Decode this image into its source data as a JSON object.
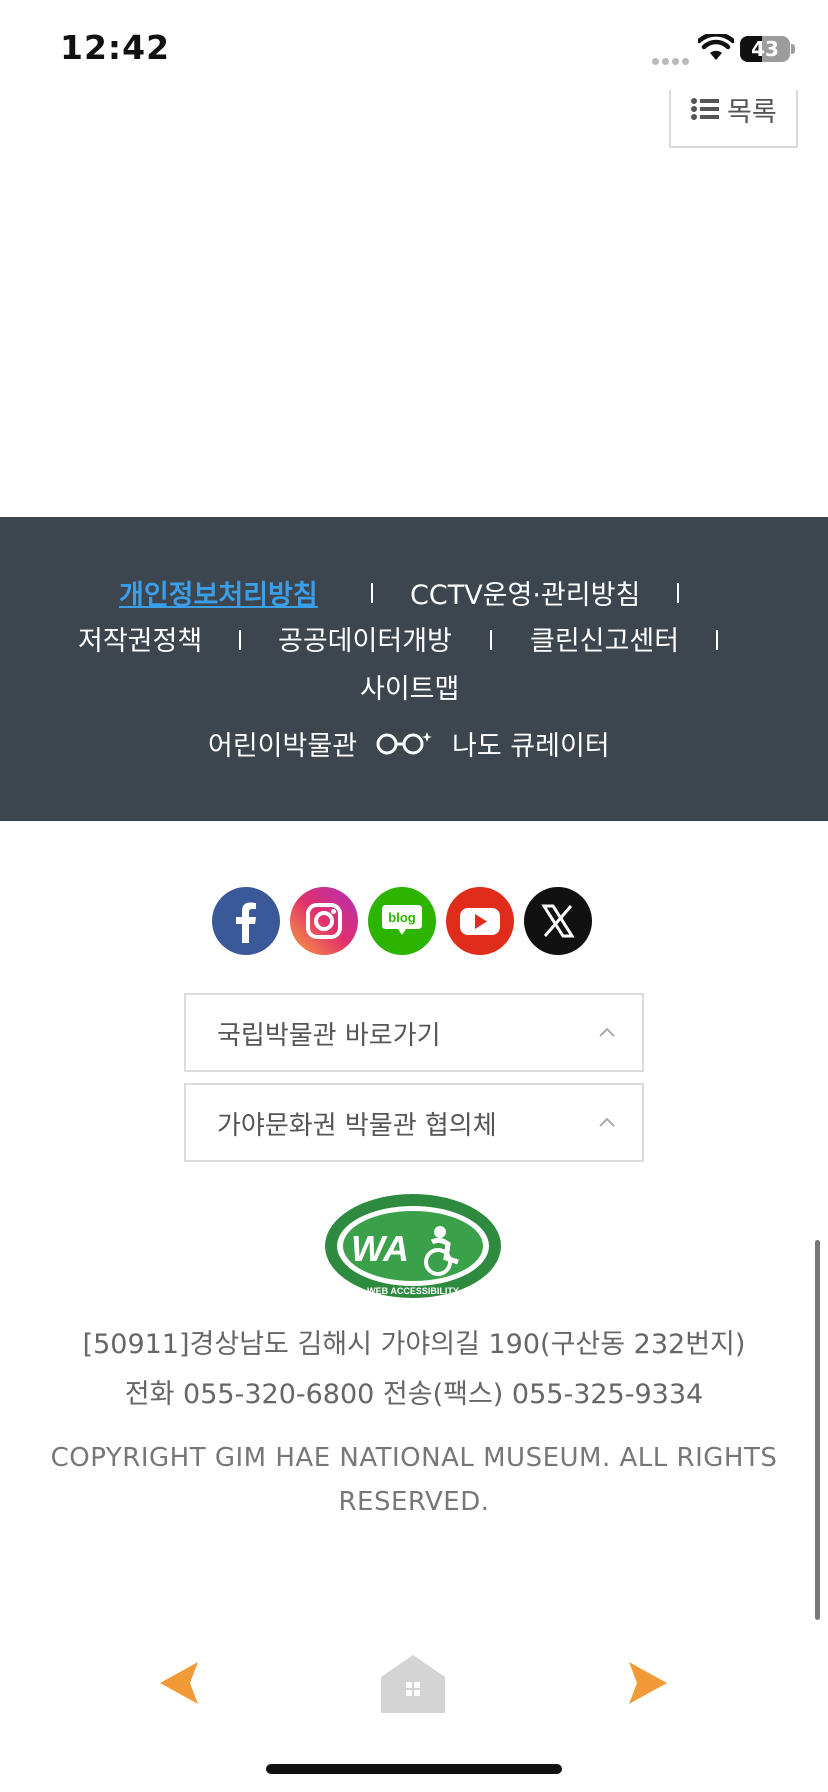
{
  "status_bar": {
    "time": "12:42",
    "battery_level": "43",
    "battery_fraction": 0.43,
    "icons": [
      "signal-dots",
      "wifi-icon",
      "battery-icon"
    ]
  },
  "list_button": {
    "label": "목록",
    "icon": "list-icon"
  },
  "footer_links": [
    {
      "label": "개인정보처리방침",
      "highlight": true
    },
    {
      "label": "CCTV운영·관리방침"
    },
    {
      "label": "저작권정책"
    },
    {
      "label": "공공데이터개방"
    },
    {
      "label": "클린신고센터"
    },
    {
      "label": "사이트맵"
    }
  ],
  "curator": {
    "left": "어린이박물관",
    "icon": "glasses-icon",
    "right": "나도 큐레이터"
  },
  "social": [
    {
      "name": "facebook",
      "color": "#3b5998"
    },
    {
      "name": "instagram",
      "color": "#e1306c"
    },
    {
      "name": "blog",
      "label": "blog",
      "color": "#2db400"
    },
    {
      "name": "youtube",
      "color": "#e02d1b"
    },
    {
      "name": "x",
      "color": "#111111"
    }
  ],
  "selects": [
    {
      "label": "국립박물관 바로가기"
    },
    {
      "label": "가야문화권 박물관 협의체"
    }
  ],
  "wa_mark": {
    "icon": "web-accessibility-mark",
    "text": "WA",
    "ring_text": "WEB ACCESSIBILITY"
  },
  "address": {
    "line1": "[50911]경상남도 김해시 가야의길 190(구산동 232번지)",
    "line2": "전화 055-320-6800 전송(팩스) 055-325-9334"
  },
  "copyright": "COPYRIGHT GIM HAE NATIONAL MUSEUM. ALL RIGHTS RESERVED.",
  "bottom_nav": {
    "icons": [
      "prev-arrow-icon",
      "home-icon",
      "next-arrow-icon"
    ],
    "accent": "#f39a38"
  },
  "colors": {
    "footer_bg": "#3d464e",
    "link_highlight": "#3a9ee8"
  }
}
